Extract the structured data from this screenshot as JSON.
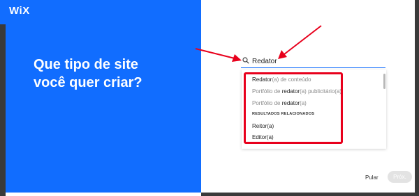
{
  "brand": {
    "logo": "WiX",
    "panel_color": "#116dff"
  },
  "left": {
    "headline_line1": "Que tipo de site",
    "headline_line2": "você quer criar?"
  },
  "search": {
    "icon": "search-icon",
    "value": "Redator"
  },
  "dropdown": {
    "items": [
      {
        "prefix": "",
        "match": "Redator",
        "suffix": "(a) de conteúdo"
      },
      {
        "prefix": "Portfólio de ",
        "match": "redator",
        "suffix": "(a) publicitário(a)"
      },
      {
        "prefix": "Portfólio de ",
        "match": "redator",
        "suffix": "(a)"
      }
    ],
    "related_header": "RESULTADOS RELACIONADOS",
    "related": [
      "Reitor(a)",
      "Editor(a)"
    ]
  },
  "footer": {
    "skip_label": "Pular",
    "next_label": "Próx."
  },
  "annotation": {
    "arrow_color": "#e8001c",
    "box_color": "#e8001c"
  }
}
